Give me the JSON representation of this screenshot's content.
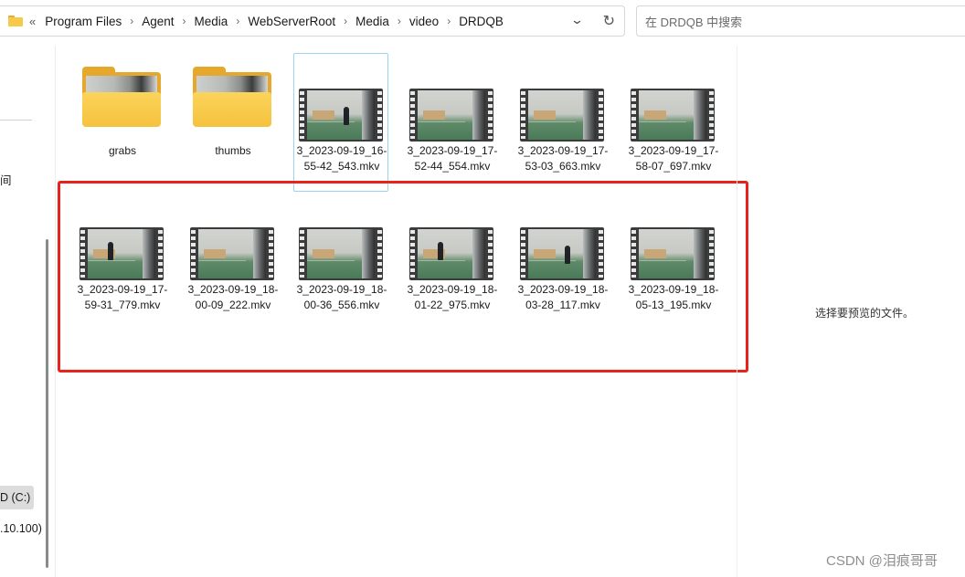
{
  "address_bar": {
    "overflow": "«",
    "crumbs": [
      "Program Files",
      "Agent",
      "Media",
      "WebServerRoot",
      "Media",
      "video",
      "DRDQB"
    ],
    "separator": "›"
  },
  "search": {
    "placeholder": "在 DRDQB 中搜索"
  },
  "nav": {
    "items": [
      {
        "label": "间"
      },
      {
        "label": "D (C:)"
      },
      {
        "label": ".10.100)"
      }
    ]
  },
  "folders": [
    {
      "name": "grabs"
    },
    {
      "name": "thumbs"
    }
  ],
  "videos_row1": [
    {
      "name": "3_2023-09-19_16-55-42_543.mkv"
    },
    {
      "name": "3_2023-09-19_17-52-44_554.mkv"
    },
    {
      "name": "3_2023-09-19_17-53-03_663.mkv"
    },
    {
      "name": "3_2023-09-19_17-58-07_697.mkv"
    }
  ],
  "videos_row2": [
    {
      "name": "3_2023-09-19_17-59-31_779.mkv"
    },
    {
      "name": "3_2023-09-19_18-00-09_222.mkv"
    },
    {
      "name": "3_2023-09-19_18-00-36_556.mkv"
    },
    {
      "name": "3_2023-09-19_18-01-22_975.mkv"
    },
    {
      "name": "3_2023-09-19_18-03-28_117.mkv"
    },
    {
      "name": "3_2023-09-19_18-05-13_195.mkv"
    }
  ],
  "preview": {
    "message": "选择要预览的文件。"
  },
  "watermark": "CSDN @泪痕哥哥",
  "colors": {
    "highlight": "#e8231c",
    "focus_border": "#9cd3f0",
    "folder": "#f5c23e"
  }
}
